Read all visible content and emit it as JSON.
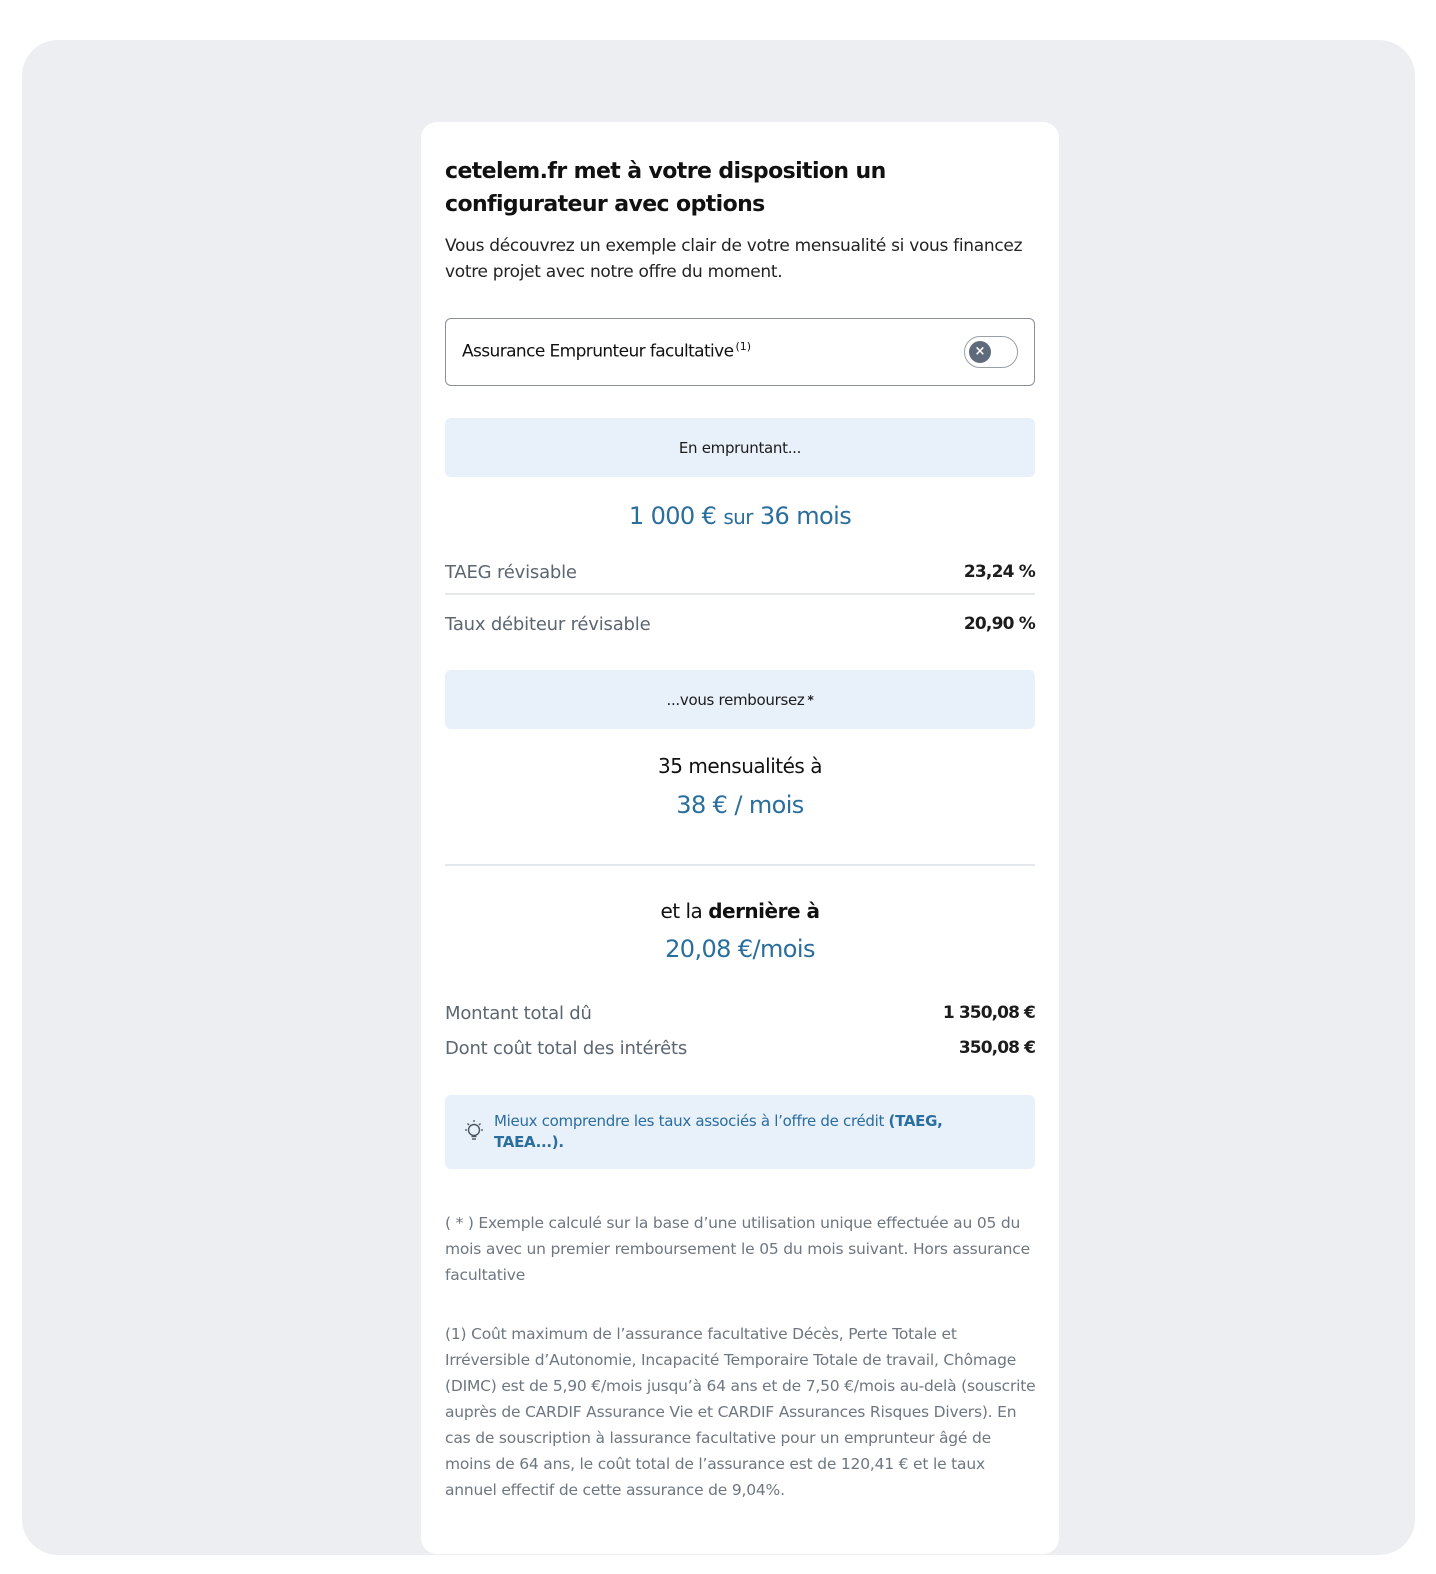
{
  "card": {
    "title": "cetelem.fr met à votre disposition un configurateur avec options",
    "intro": "Vous découvrez un exemple clair de votre mensualité si vous financez votre projet avec notre offre du moment."
  },
  "insurance_toggle": {
    "label": "Assurance Emprunteur facultative",
    "note_marker": "(1)",
    "state": "off",
    "knob_glyph": "×"
  },
  "borrow_band": {
    "label": "En empruntant..."
  },
  "loan": {
    "amount": "1 000 €",
    "connector": "sur",
    "duration": "36 mois"
  },
  "rates": [
    {
      "label": "TAEG révisable",
      "value": "23,24 %"
    },
    {
      "label": "Taux débiteur révisable",
      "value": "20,90 %"
    }
  ],
  "repay_band": {
    "label": "...vous remboursez",
    "marker": "*"
  },
  "installments": {
    "count_text": "35 mensualités à",
    "amount": "38 € / mois"
  },
  "last_installment": {
    "prefix": "et la",
    "bold": "dernière à",
    "amount": "20,08 €/mois"
  },
  "totals": [
    {
      "label": "Montant total dû",
      "value": "1 350,08 €"
    },
    {
      "label": "Dont coût total des intérêts",
      "value": "350,08 €"
    }
  ],
  "info_link": {
    "icon": "lightbulb-icon",
    "text": "Mieux comprendre les taux associés à l’offre de crédit",
    "bold": "(TAEG, TAEA...)."
  },
  "footnotes": [
    "( * ) Exemple calculé sur la base d’une utilisation unique effectuée au 05 du mois avec un premier remboursement le 05 du mois suivant. Hors assurance facultative",
    "(1) Coût maximum de l’assurance facultative Décès, Perte Totale et Irréversible d’Autonomie, Incapacité Temporaire Totale de travail, Chômage (DIMC) est de 5,90 €/mois jusqu’à 64 ans et de 7,50 €/mois au-delà (souscrite auprès de CARDIF Assurance Vie et CARDIF Assurances Risques Divers). En cas de souscription à lassurance facultative pour un emprunteur âgé de moins de 64 ans, le coût total de l’assurance est de 120,41 € et le taux annuel effectif de cette assurance de 9,04%."
  ],
  "colors": {
    "accent_blue": "#2a6e9e",
    "band_bg": "#e8f0fa",
    "page_bg": "#edeef2"
  }
}
